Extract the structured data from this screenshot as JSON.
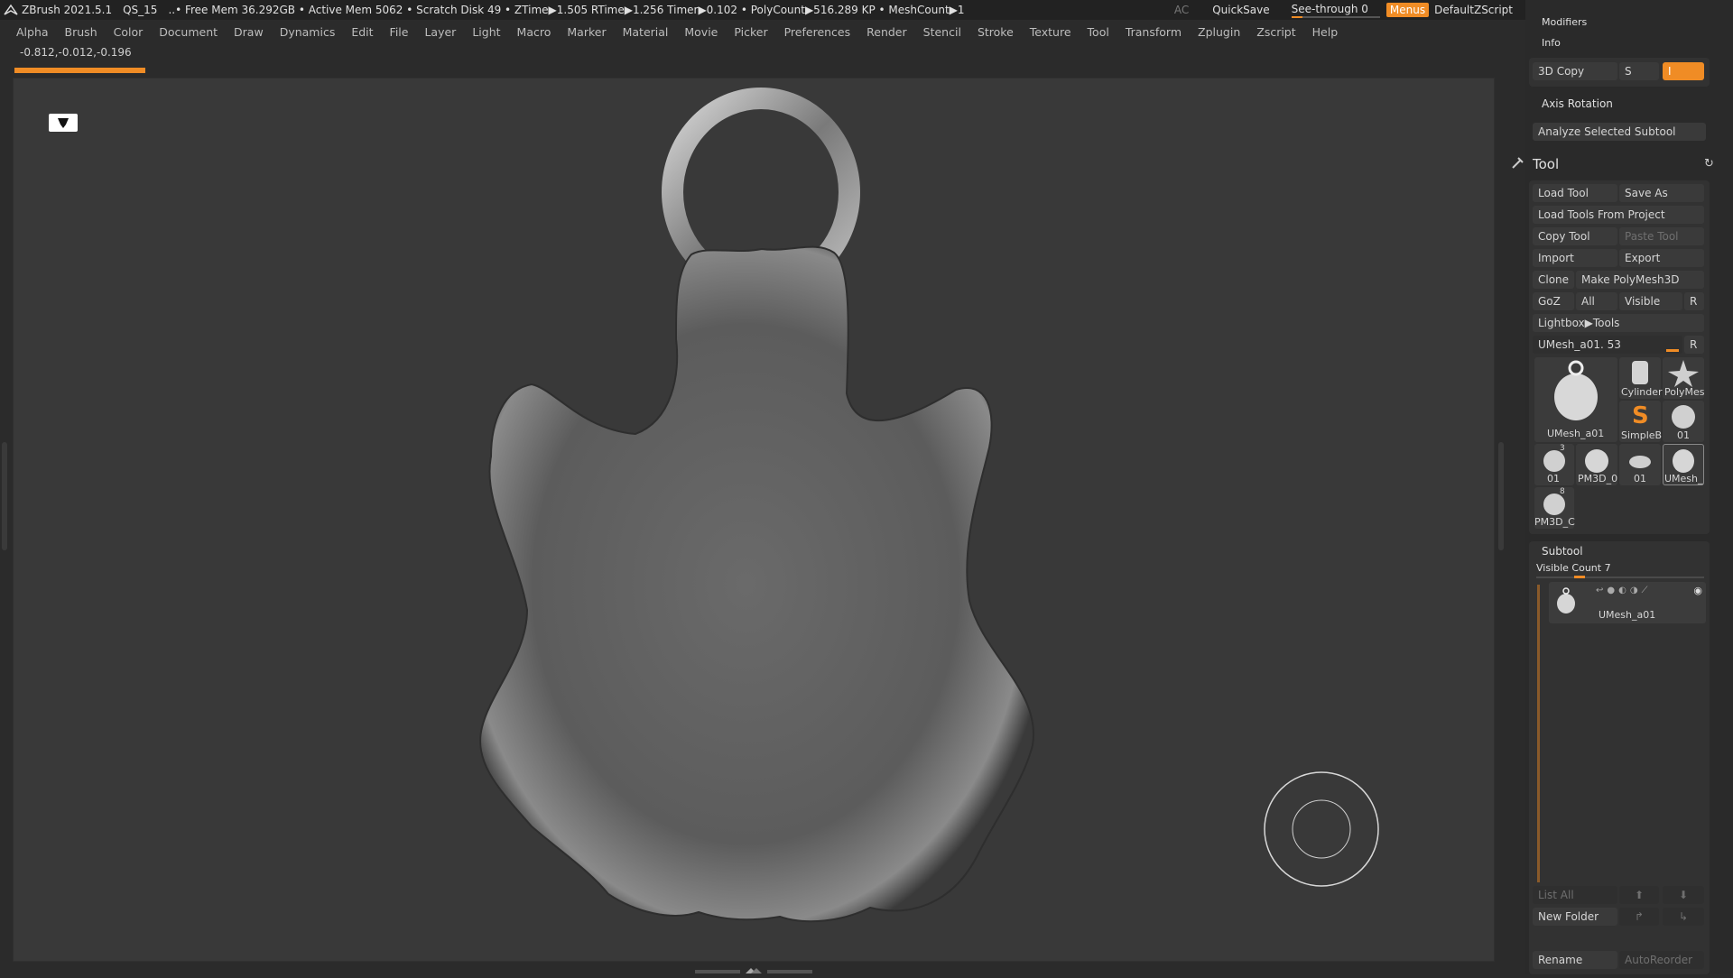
{
  "titlebar": {
    "app": "ZBrush 2021.5.1",
    "doc": "QS_15",
    "stats": "..• Free Mem 36.292GB • Active Mem 5062 • Scratch Disk 49 •  ZTime▶1.505 RTime▶1.256 Timer▶0.102 • PolyCount▶516.289 KP  • MeshCount▶1",
    "ac": "AC",
    "quicksave": "QuickSave",
    "seethrough": "See-through  0",
    "seethrough_value": 0,
    "menus": "Menus",
    "script": "DefaultZScript"
  },
  "menubar": [
    "Alpha",
    "Brush",
    "Color",
    "Document",
    "Draw",
    "Dynamics",
    "Edit",
    "File",
    "Layer",
    "Light",
    "Macro",
    "Marker",
    "Material",
    "Movie",
    "Picker",
    "Preferences",
    "Render",
    "Stencil",
    "Stroke",
    "Texture",
    "Tool",
    "Transform",
    "Zplugin",
    "Zscript",
    "Help"
  ],
  "coords": "-0.812,-0.012,-0.196",
  "colors": {
    "accent": "#f08c25",
    "panel": "#2a2a2a",
    "button": "#3a3a3a",
    "viewport": "#393939"
  },
  "panel": {
    "modifiers": "Modifiers",
    "info": "Info",
    "copy3d": "3D Copy",
    "s_label": "S",
    "i_label": "I",
    "axis_rotation": "Axis Rotation",
    "analyze": "Analyze Selected Subtool",
    "tool_title": "Tool",
    "buttons": {
      "load_tool": "Load Tool",
      "save_as": "Save As",
      "load_from_project": "Load Tools From Project",
      "copy_tool": "Copy Tool",
      "paste_tool": "Paste Tool",
      "import": "Import",
      "export": "Export",
      "clone": "Clone",
      "make_polymesh": "Make PolyMesh3D",
      "goz": "GoZ",
      "all": "All",
      "visible": "Visible",
      "r": "R",
      "lightbox_tools": "Lightbox▶Tools"
    },
    "current_tool": "UMesh_a01. 53",
    "current_tool_r": "R",
    "tools": [
      {
        "label": "UMesh_a01"
      },
      {
        "label": "Cylinder"
      },
      {
        "label": "PolyMes"
      },
      {
        "label": "SimpleB"
      },
      {
        "label": "01"
      },
      {
        "label": "01"
      },
      {
        "label": "PM3D_0"
      },
      {
        "label": "01"
      },
      {
        "label": "UMesh_"
      },
      {
        "label": "PM3D_C"
      }
    ],
    "tool_badges": {
      "three": "3",
      "eight": "8"
    },
    "subtool": {
      "title": "Subtool",
      "visible_count": "Visible Count 7",
      "item_name": "UMesh_a01",
      "list_all": "List All",
      "new_folder": "New Folder",
      "rename": "Rename",
      "autoreorder": "AutoReorder"
    }
  }
}
